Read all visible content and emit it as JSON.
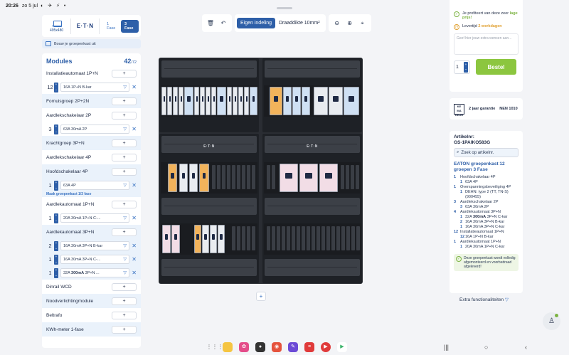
{
  "status_bar": {
    "time": "20:26",
    "date": "zo 5 jul",
    "icons": "◐ ✈ ⚡ •"
  },
  "left": {
    "dimensions": "495x480",
    "brand": "E·T·N",
    "phases": [
      "1 Fase",
      "3 Fase"
    ],
    "build_label": "Bouw je groepenkast uit",
    "modules_title": "Modules",
    "modules_count": "42",
    "modules_total": "/72",
    "groups": [
      {
        "name": "Installatieautomaat 1P+N",
        "add": "+",
        "items": [
          {
            "qty": "12",
            "text": "16A 1P+N B-kar"
          }
        ]
      },
      {
        "name": "Fornuisgroep 2P+2N",
        "add": "+",
        "items": []
      },
      {
        "name": "Aardlekschakelaar 2P",
        "add": "+",
        "items": [
          {
            "qty": "3",
            "text": "63A 30mA 2P"
          }
        ]
      },
      {
        "name": "Krachtgroep 3P+N",
        "add": "+",
        "items": []
      },
      {
        "name": "Aardlekschakelaar 4P",
        "add": "+",
        "items": []
      },
      {
        "name": "Hoofdschakelaar 4P",
        "add": "+",
        "items": [
          {
            "qty": "1",
            "text": "63A 4P"
          }
        ],
        "link": "Maak groepenkast 1/3 fase"
      },
      {
        "name": "Aardlekautomaat 1P+N",
        "add": "+",
        "items": [
          {
            "qty": "1",
            "text": "20A 30mA 1P+N C-..."
          }
        ]
      },
      {
        "name": "Aardlekautomaat 3P+N",
        "add": "+",
        "items": [
          {
            "qty": "2",
            "text": "16A 30mA 3P+N B-kar"
          },
          {
            "qty": "1",
            "text": "16A 30mA 3P+N C-..."
          },
          {
            "qty": "1",
            "text_pre": "32A ",
            "text_bold": "300mA",
            "text_post": " 3P+N ..."
          }
        ]
      },
      {
        "name": "Dinrail WCD",
        "add": "+",
        "items": []
      },
      {
        "name": "Noodverlichtingmodule",
        "add": "+",
        "items": []
      },
      {
        "name": "Beltrafo",
        "add": "+",
        "items": []
      },
      {
        "name": "KWh-meter 1-fase",
        "add": "+",
        "items": []
      }
    ]
  },
  "toolbar": {
    "delete_icon": "trash-icon",
    "undo_icon": "undo-icon",
    "view_custom": "Eigen indeling",
    "wire_thickness": "Draaddikte 10mm²",
    "zoom_out": "⊖",
    "zoom_in": "⊕",
    "recenter": "⌖"
  },
  "cabinet": {
    "brand": "E·T·N",
    "add_row": "+"
  },
  "order": {
    "benefit_pre": "Je profiteert van deze zeer ",
    "benefit_hl": "lage prijs!",
    "delivery_pre": "Levertijd ",
    "delivery_hl": "2 werkdagen",
    "remark_placeholder": "Geef hier jouw extra wensen aan...",
    "qty": "1",
    "buy_label": "Bestel"
  },
  "warranty": {
    "kema": "KEMA KEUR",
    "years": "2 jaar garantie",
    "nen": "NEN 1010"
  },
  "article": {
    "label": "Artikelnr:",
    "code": "GS-1PAIKO583G",
    "search_label": "Zoek op artikelnr.",
    "title": "EATON groepenkast 12 groepen 3 Fase",
    "spec": [
      {
        "n": "1",
        "text": "Hoofdschakelaar 4P",
        "subs": [
          {
            "n": "1",
            "text": "63A 4P"
          }
        ]
      },
      {
        "n": "1",
        "text": "Overspanningsbeveiliging 4P",
        "subs": [
          {
            "n": "1",
            "text": "DEHN: type 2 (TT, TN-S) (900455)"
          }
        ]
      },
      {
        "n": "3",
        "text": "Aardlekschakelaar 2P",
        "subs": [
          {
            "n": "3",
            "text": "63A 30mA 2P"
          }
        ]
      },
      {
        "n": "4",
        "text": "Aardlekautomaat 3P+N",
        "subs": [
          {
            "n": "1",
            "text_pre": "32A ",
            "text_bold": "300mA",
            "text_post": " 3P+N C-kar"
          },
          {
            "n": "2",
            "text": "16A 30mA 3P+N B-kar"
          },
          {
            "n": "1",
            "text": "16A 30mA 3P+N C-kar"
          }
        ]
      },
      {
        "n": "12",
        "text": "Installatieautomaat 1P+N",
        "subs": [
          {
            "n": "12",
            "text": "16A 1P+N B-kar"
          }
        ]
      },
      {
        "n": "1",
        "text": "Aardlekautomaat 1P+N",
        "subs": [
          {
            "n": "1",
            "text": "20A 30mA 1P+N C-kar"
          }
        ]
      }
    ],
    "assembled_note": "Deze groepenkast wordt volledig afgemonteerd en voorbedraad afgeleverd!"
  },
  "extra_label": "Extra functionaliteiten",
  "colors": {
    "accent": "#2e5fa8",
    "buy": "#8cc63f",
    "highlight": "#7cb342",
    "warn": "#e0a030"
  }
}
